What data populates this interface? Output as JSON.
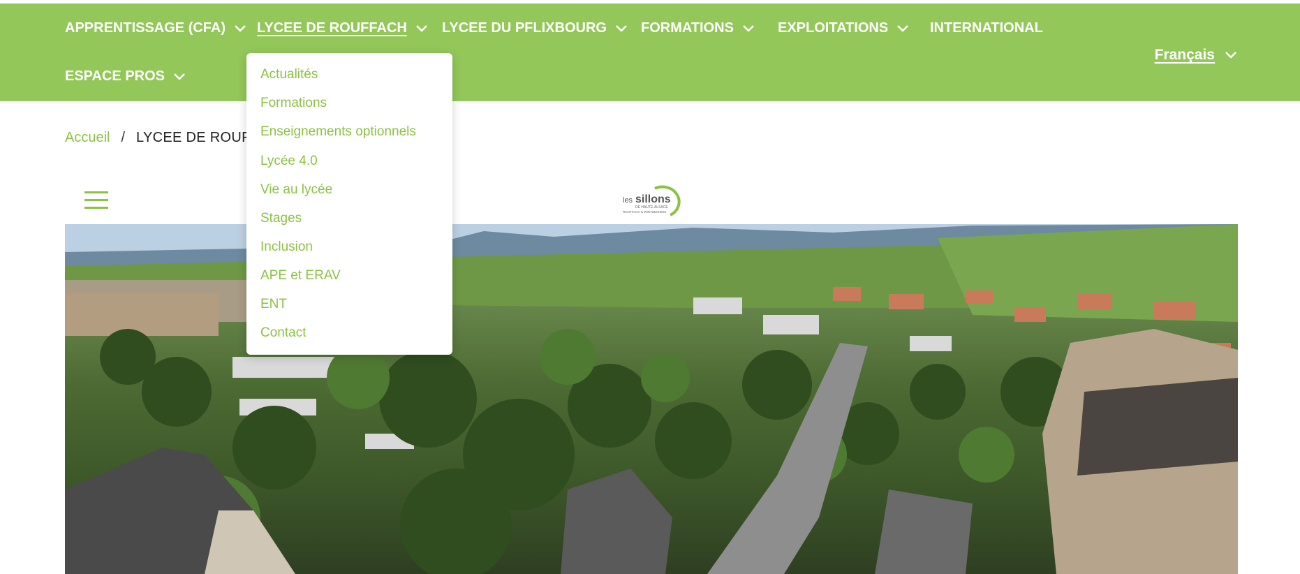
{
  "nav": {
    "items": [
      {
        "label": "APPRENTISSAGE (CFA)",
        "has_dropdown": true
      },
      {
        "label": "LYCEE DE ROUFFACH",
        "has_dropdown": true,
        "active": true
      },
      {
        "label": "LYCEE DU PFLIXBOURG",
        "has_dropdown": true
      },
      {
        "label": "FORMATIONS",
        "has_dropdown": true
      },
      {
        "label": "EXPLOITATIONS",
        "has_dropdown": true
      },
      {
        "label": "INTERNATIONAL",
        "has_dropdown": false
      },
      {
        "label": "ESPACE PROS",
        "has_dropdown": true
      }
    ],
    "language": "Français"
  },
  "dropdown": {
    "items": [
      "Actualités",
      "Formations",
      "Enseignements optionnels",
      "Lycée 4.0",
      "Vie au lycée",
      "Stages",
      "Inclusion",
      "APE et ERAV",
      "ENT",
      "Contact"
    ]
  },
  "breadcrumb": {
    "home": "Accueil",
    "separator": "/",
    "current": "LYCEE DE ROUFF"
  },
  "logo": {
    "line1": "les",
    "line2": "sillons",
    "line3": "DE HAUTE-ALSACE",
    "line4": "ROUFFACH & WINTZENHEIM"
  },
  "colors": {
    "brand_green": "#93c75a",
    "link_green": "#8cc244"
  },
  "icons": {
    "menu": "hamburger-icon",
    "dropdown": "chevron-down-icon"
  }
}
